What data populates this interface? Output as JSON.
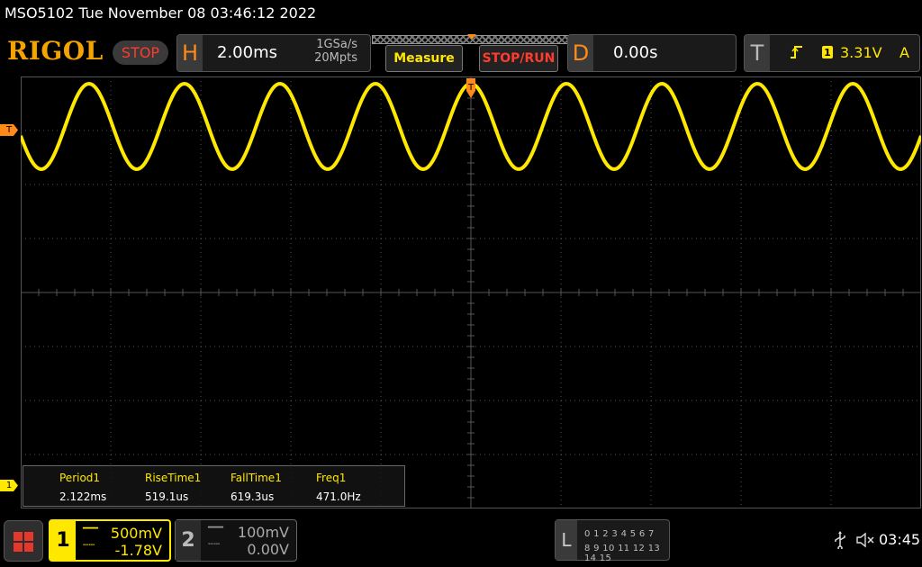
{
  "title_line": "MSO5102  Tue November 08 03:46:12 2022",
  "header": {
    "logo": "RIGOL",
    "run_state": "STOP",
    "horizontal": {
      "letter": "H",
      "timebase": "2.00ms",
      "sample_rate": "1GSa/s",
      "memory_depth": "20Mpts"
    },
    "measure_button": "Measure",
    "stop_run_button": "STOP/RUN",
    "delay": {
      "letter": "D",
      "value": "0.00s"
    },
    "trigger": {
      "letter": "T",
      "edge_icon": "rising-edge-icon",
      "source": "1",
      "level": "3.31V",
      "mode": "A"
    }
  },
  "markers": {
    "trigger_level": "T",
    "ch1_offset": "1",
    "trigger_position": "T"
  },
  "measurements": [
    {
      "name": "Period1",
      "value": "2.122ms"
    },
    {
      "name": "RiseTime1",
      "value": "519.1us"
    },
    {
      "name": "FallTime1",
      "value": "619.3us"
    },
    {
      "name": "Freq1",
      "value": "471.0Hz"
    }
  ],
  "channels": [
    {
      "number": "1",
      "coupling": "DC",
      "scale": "500mV",
      "offset": "-1.78V",
      "active": true
    },
    {
      "number": "2",
      "coupling": "DC",
      "scale": "100mV",
      "offset": "0.00V",
      "active": false
    }
  ],
  "logic": {
    "letter": "L",
    "row1": "0 1 2 3  4 5 6 7",
    "row2": "8 9 10 11 12 13 14 15"
  },
  "status": {
    "clock": "03:45"
  },
  "colors": {
    "ch1": "#ffe800",
    "accent": "#ff8a1a",
    "stop": "#ff3b2f",
    "grid": "#555555"
  },
  "waveform": {
    "channel": "1",
    "shape": "sine",
    "cycles_on_screen": 9.43
  }
}
